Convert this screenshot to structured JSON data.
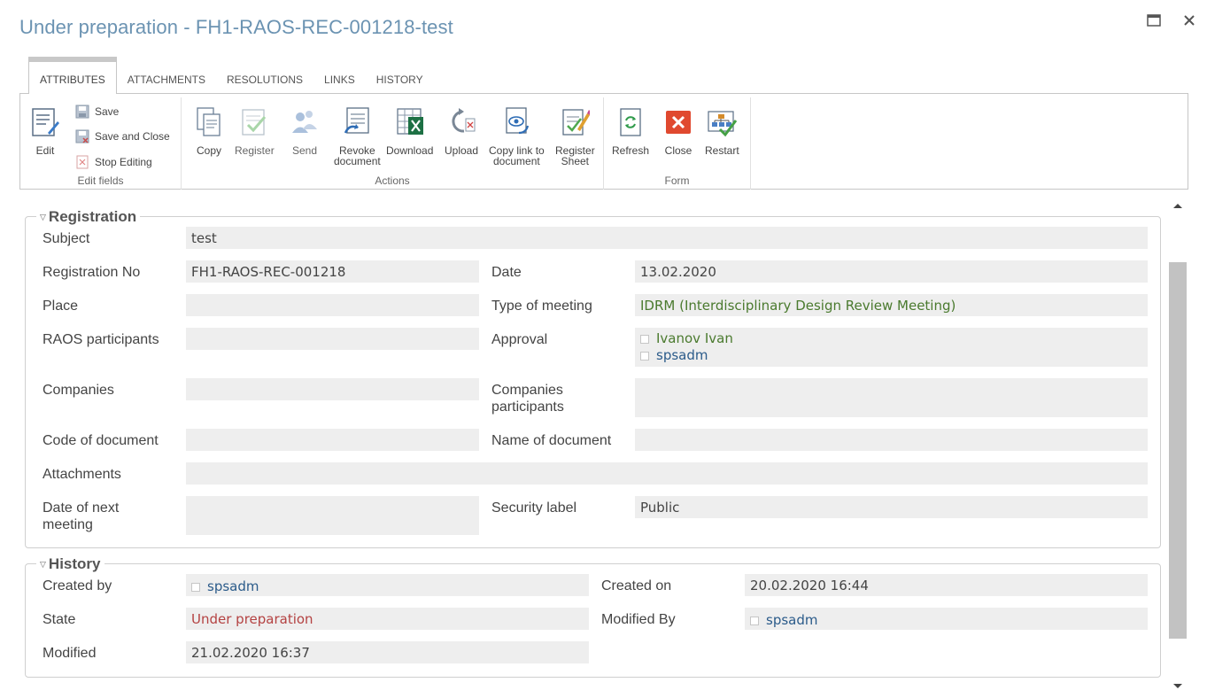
{
  "title": "Under preparation - FH1-RAOS-REC-001218-test",
  "window": {
    "maximize_icon": "maximize-icon",
    "close_icon": "close-icon"
  },
  "tabs": [
    {
      "label": "ATTRIBUTES"
    },
    {
      "label": "ATTACHMENTS"
    },
    {
      "label": "RESOLUTIONS"
    },
    {
      "label": "LINKS"
    },
    {
      "label": "HISTORY"
    }
  ],
  "ribbon": {
    "edit_fields": {
      "label": "Edit fields",
      "edit": "Edit",
      "save": "Save",
      "save_close": "Save and Close",
      "stop_editing": "Stop Editing"
    },
    "actions": {
      "label": "Actions",
      "copy": "Copy",
      "register": "Register",
      "send": "Send",
      "revoke": "Revoke\ndocument",
      "download": "Download",
      "upload": "Upload",
      "copy_link": "Copy link to\ndocument",
      "register_sheet": "Register\nSheet"
    },
    "form": {
      "label": "Form",
      "refresh": "Refresh",
      "close": "Close",
      "restart": "Restart"
    }
  },
  "registration": {
    "legend": "Registration",
    "subject_label": "Subject",
    "subject": "test",
    "regno_label": "Registration No",
    "regno": "FH1-RAOS-REC-001218",
    "date_label": "Date",
    "date": "13.02.2020",
    "place_label": "Place",
    "place": "",
    "meeting_type_label": "Type of meeting",
    "meeting_type": "IDRM (Interdisciplinary Design Review Meeting)",
    "raos_label": "RAOS participants",
    "raos": "",
    "approval_label": "Approval",
    "approval": [
      "Ivanov Ivan",
      "spsadm"
    ],
    "companies_label": "Companies",
    "companies": "",
    "companies_participants_label": "Companies\nparticipants",
    "companies_participants": "",
    "code_label": "Code of document",
    "code": "",
    "name_label": "Name of document",
    "name": "",
    "attachments_label": "Attachments",
    "attachments": "",
    "next_meeting_label": "Date of next\nmeeting",
    "next_meeting": "",
    "security_label": "Security label",
    "security": "Public"
  },
  "history": {
    "legend": "History",
    "created_by_label": "Created by",
    "created_by": "spsadm",
    "created_on_label": "Created on",
    "created_on": "20.02.2020 16:44",
    "state_label": "State",
    "state": "Under preparation",
    "modified_by_label": "Modified By",
    "modified_by": "spsadm",
    "modified_label": "Modified",
    "modified": "21.02.2020 16:37"
  },
  "colors": {
    "title": "#6b93b2",
    "link": "#2b5b8a",
    "green_value": "#4a7a2e",
    "state_red": "#b44242",
    "field_bg": "#eeeeee"
  }
}
